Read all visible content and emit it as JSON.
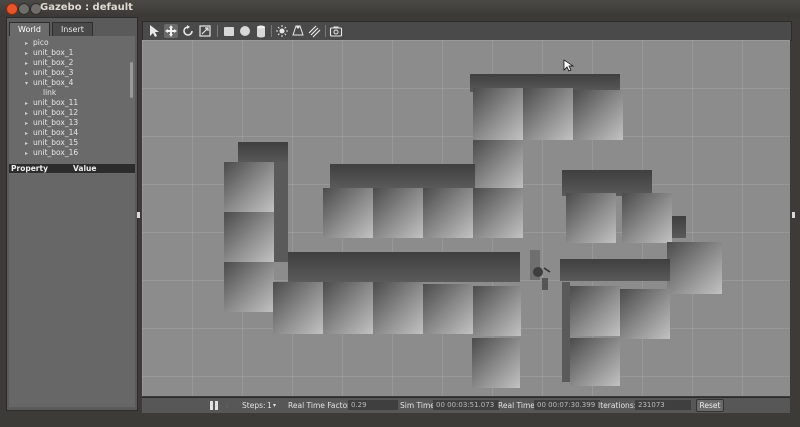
{
  "window": {
    "title": "Gazebo : default"
  },
  "left_panel": {
    "tabs": [
      {
        "label": "World"
      },
      {
        "label": "Insert"
      }
    ],
    "tree": [
      {
        "label": "pico"
      },
      {
        "label": "unit_box_1"
      },
      {
        "label": "unit_box_2"
      },
      {
        "label": "unit_box_3"
      },
      {
        "label": "unit_box_4"
      },
      {
        "label": "link"
      },
      {
        "label": "unit_box_11"
      },
      {
        "label": "unit_box_12"
      },
      {
        "label": "unit_box_13"
      },
      {
        "label": "unit_box_14"
      },
      {
        "label": "unit_box_15"
      },
      {
        "label": "unit_box_16"
      }
    ],
    "properties": {
      "col_property": "Property",
      "col_value": "Value"
    }
  },
  "toolbar": {
    "icons": [
      "select-arrow-icon",
      "translate-icon",
      "rotate-icon",
      "scale-icon",
      "box-icon",
      "sphere-icon",
      "cylinder-icon",
      "point-light-icon",
      "spot-light-icon",
      "directional-light-icon",
      "screenshot-icon"
    ]
  },
  "bottom_bar": {
    "steps_label": "Steps:",
    "steps_value": "1",
    "rtf_label": "Real Time Factor:",
    "rtf_value": "0.29",
    "sim_time_label": "Sim Time:",
    "sim_time_value": "00 00:03:51.073",
    "real_time_label": "Real Time:",
    "real_time_value": "00 00:07:30.399",
    "iterations_label": "Iterations:",
    "iterations_value": "231073",
    "reset_label": "Reset"
  },
  "colors": {
    "window_bg": "#3c3b37",
    "panel_bg": "#5a5a5a",
    "viewport_ground": "#8c8c8c",
    "close_button": "#e4552a"
  }
}
